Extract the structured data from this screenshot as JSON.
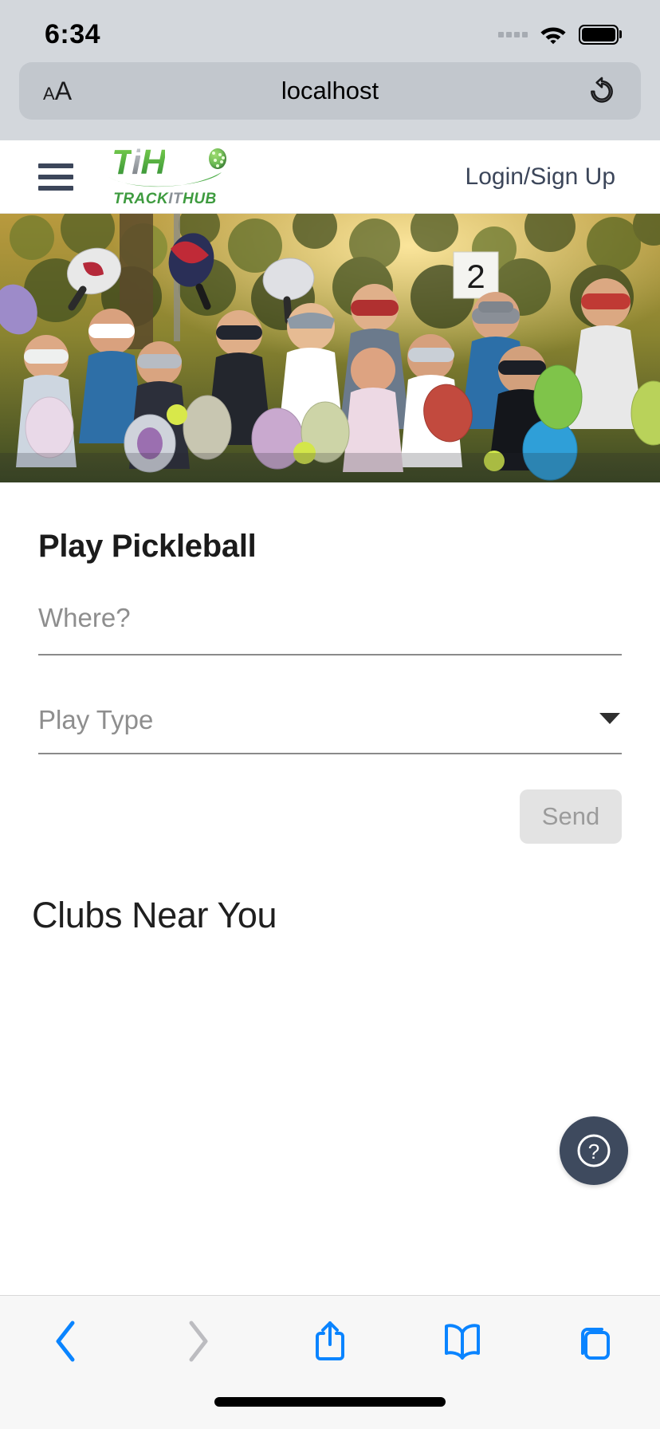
{
  "status_bar": {
    "time": "6:34",
    "signal_icon": "signal-dots-icon",
    "wifi_icon": "wifi-icon",
    "battery_icon": "battery-full-icon"
  },
  "browser": {
    "text_size_label": "AA",
    "url": "localhost",
    "reload_icon": "reload-icon",
    "toolbar": {
      "back_label": "back-chevron-icon",
      "forward_label": "forward-chevron-icon",
      "share_label": "share-icon",
      "bookmarks_label": "bookmarks-book-icon",
      "tabs_label": "tabs-icon"
    }
  },
  "site_header": {
    "menu_icon": "hamburger-menu-icon",
    "logo": {
      "mark_t": "T",
      "mark_i": "i",
      "mark_h": "H",
      "wordmark_part1": "TRACK",
      "wordmark_part2": "IT",
      "wordmark_part3": "HUB",
      "ball_icon": "pickleball-icon"
    },
    "login_label": "Login/Sign Up"
  },
  "hero": {
    "alt": "group-of-pickleball-players-holding-paddles",
    "court_sign_number": "2"
  },
  "main": {
    "play_title": "Play Pickleball",
    "where_input": {
      "placeholder": "Where?",
      "value": ""
    },
    "play_type_select": {
      "label": "Play Type",
      "value": "",
      "caret_icon": "chevron-down-icon"
    },
    "send_button": "Send",
    "clubs_title": "Clubs Near You"
  },
  "help_fab": {
    "icon": "question-mark-circle-icon",
    "label": "?"
  },
  "colors": {
    "status_bar_bg": "#d3d7dc",
    "url_pill_bg": "#c2c7cd",
    "brand_green": "#3e9b3f",
    "brand_green_light": "#7fd34f",
    "brand_slate": "#3c465a",
    "safari_blue": "#0a84ff",
    "fab_bg": "#3e4a5e",
    "send_disabled_bg": "#e3e3e3",
    "send_disabled_text": "#9b9b9b",
    "field_underline": "#8a8a8a"
  }
}
